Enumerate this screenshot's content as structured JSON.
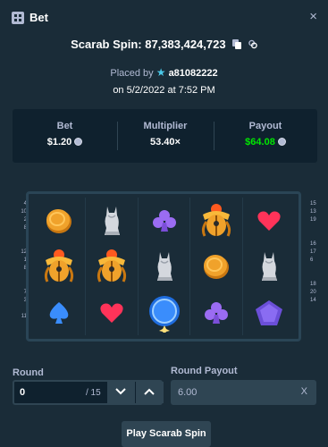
{
  "header": {
    "title": "Bet",
    "close": "×"
  },
  "game": {
    "title": "Scarab Spin: 87,383,424,723"
  },
  "placed": {
    "prefix": "Placed by",
    "user": "a81082222",
    "date": "on 5/2/2022 at 7:52 PM"
  },
  "stats": {
    "bet_label": "Bet",
    "bet_value": "$1.20",
    "mult_label": "Multiplier",
    "mult_value": "53.40×",
    "payout_label": "Payout",
    "payout_value": "$64.08"
  },
  "paylines": {
    "left": [
      "4",
      "10",
      "2",
      "8",
      "",
      "",
      "12",
      "1",
      "8",
      "",
      "",
      "7",
      "3",
      "",
      "11"
    ],
    "right": [
      "15",
      "13",
      "19",
      "",
      "",
      "16",
      "17",
      "6",
      "",
      "",
      "18",
      "20",
      "14"
    ]
  },
  "board": {
    "columns": 5,
    "rows": [
      [
        "coin-icon",
        "cat-statue-icon",
        "club-icon",
        "scarab-icon",
        "heart-icon"
      ],
      [
        "scarab-icon",
        "scarab-icon",
        "cat-statue-icon",
        "coin-icon",
        "cat-statue-icon"
      ],
      [
        "spade-icon",
        "heart-icon",
        "blue-orb-icon",
        "club-icon",
        "gem-icon"
      ]
    ]
  },
  "round": {
    "label": "Round",
    "value": "0",
    "total": "/ 15"
  },
  "round_payout": {
    "label": "Round Payout",
    "value": "6.00",
    "clear": "X"
  },
  "play_button": {
    "label": "Play Scarab Spin"
  },
  "colors": {
    "bg": "#1a2c38",
    "panel": "#0f212e",
    "green": "#00e701",
    "muted": "#b1bad3"
  }
}
